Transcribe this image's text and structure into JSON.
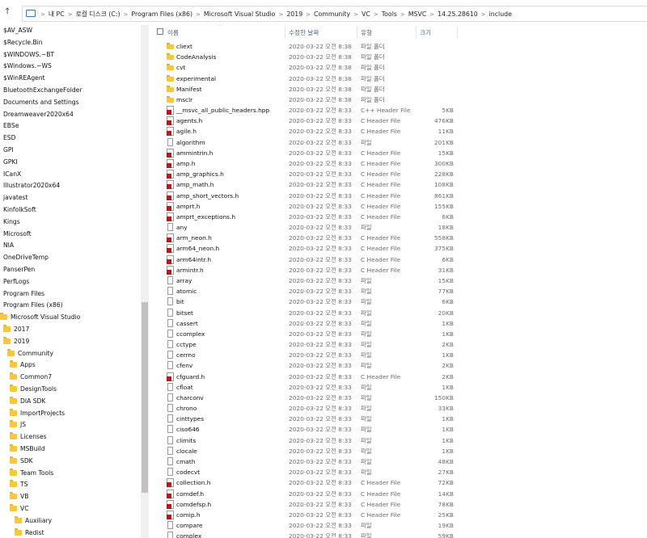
{
  "nav": {
    "back": "←",
    "forward": "→",
    "dropdown": "∨",
    "up": "↑"
  },
  "breadcrumb": [
    "내 PC",
    "로컬 디스크 (C:)",
    "Program Files (x86)",
    "Microsoft Visual Studio",
    "2019",
    "Community",
    "VC",
    "Tools",
    "MSVC",
    "14.25.28610",
    "include"
  ],
  "columns": {
    "name": "이름",
    "date": "수정한 날짜",
    "type": "유형",
    "size": "크기"
  },
  "sidebar": [
    {
      "label": "$AV_ASW",
      "folder": false,
      "indent": 0
    },
    {
      "label": "$Recycle.Bin",
      "folder": false,
      "indent": 0
    },
    {
      "label": "$WINDOWS.~BT",
      "folder": false,
      "indent": 0
    },
    {
      "label": "$Windows.~WS",
      "folder": false,
      "indent": 0
    },
    {
      "label": "$WinREAgent",
      "folder": false,
      "indent": 0
    },
    {
      "label": "BluetoothExchangeFolder",
      "folder": false,
      "indent": 0
    },
    {
      "label": "Documents and Settings",
      "folder": false,
      "indent": 0
    },
    {
      "label": "Dreamweaver2020x64",
      "folder": false,
      "indent": 0
    },
    {
      "label": "EBSe",
      "folder": false,
      "indent": 0
    },
    {
      "label": "ESD",
      "folder": false,
      "indent": 0
    },
    {
      "label": "GPI",
      "folder": false,
      "indent": 0
    },
    {
      "label": "GPKI",
      "folder": false,
      "indent": 0
    },
    {
      "label": "ICanX",
      "folder": false,
      "indent": 0
    },
    {
      "label": "Illustrator2020x64",
      "folder": false,
      "indent": 0
    },
    {
      "label": "javatest",
      "folder": false,
      "indent": 0
    },
    {
      "label": "KinfolkSoft",
      "folder": false,
      "indent": 0
    },
    {
      "label": "Kings",
      "folder": false,
      "indent": 0
    },
    {
      "label": "Microsoft",
      "folder": false,
      "indent": 0
    },
    {
      "label": "NIA",
      "folder": false,
      "indent": 0
    },
    {
      "label": "OneDriveTemp",
      "folder": false,
      "indent": 0
    },
    {
      "label": "PanserPen",
      "folder": false,
      "indent": 0
    },
    {
      "label": "PerfLogs",
      "folder": false,
      "indent": 0
    },
    {
      "label": "Program Files",
      "folder": false,
      "indent": 0
    },
    {
      "label": "Program Files (x86)",
      "folder": false,
      "indent": 0
    },
    {
      "label": "Microsoft Visual Studio",
      "folder": true,
      "indent": 0
    },
    {
      "label": "2017",
      "folder": true,
      "indent": 1
    },
    {
      "label": "2019",
      "folder": true,
      "indent": 1
    },
    {
      "label": "Community",
      "folder": true,
      "indent": 2
    },
    {
      "label": "Apps",
      "folder": true,
      "indent": 3
    },
    {
      "label": "Common7",
      "folder": true,
      "indent": 3
    },
    {
      "label": "DesignTools",
      "folder": true,
      "indent": 3
    },
    {
      "label": "DIA SDK",
      "folder": true,
      "indent": 3
    },
    {
      "label": "ImportProjects",
      "folder": true,
      "indent": 3
    },
    {
      "label": "JS",
      "folder": true,
      "indent": 3
    },
    {
      "label": "Licenses",
      "folder": true,
      "indent": 3
    },
    {
      "label": "MSBuild",
      "folder": true,
      "indent": 3
    },
    {
      "label": "SDK",
      "folder": true,
      "indent": 3
    },
    {
      "label": "Team Tools",
      "folder": true,
      "indent": 3
    },
    {
      "label": "TS",
      "folder": true,
      "indent": 3
    },
    {
      "label": "VB",
      "folder": true,
      "indent": 3
    },
    {
      "label": "VC",
      "folder": true,
      "indent": 3
    },
    {
      "label": "Auxiliary",
      "folder": true,
      "indent": 4
    },
    {
      "label": "Redist",
      "folder": true,
      "indent": 4
    }
  ],
  "files": [
    {
      "name": "cliext",
      "date": "2020-03-22 오전 8:38",
      "type": "파일 폴더",
      "size": "",
      "icon": "folder"
    },
    {
      "name": "CodeAnalysis",
      "date": "2020-03-22 오전 8:38",
      "type": "파일 폴더",
      "size": "",
      "icon": "folder"
    },
    {
      "name": "cvt",
      "date": "2020-03-22 오전 8:38",
      "type": "파일 폴더",
      "size": "",
      "icon": "folder"
    },
    {
      "name": "experimental",
      "date": "2020-03-22 오전 8:38",
      "type": "파일 폴더",
      "size": "",
      "icon": "folder"
    },
    {
      "name": "Manifest",
      "date": "2020-03-22 오전 8:38",
      "type": "파일 폴더",
      "size": "",
      "icon": "folder"
    },
    {
      "name": "msclr",
      "date": "2020-03-22 오전 8:38",
      "type": "파일 폴더",
      "size": "",
      "icon": "folder"
    },
    {
      "name": "__msvc_all_public_headers.hpp",
      "date": "2020-03-22 오전 8:33",
      "type": "C++ Header File",
      "size": "5KB",
      "icon": "header"
    },
    {
      "name": "agents.h",
      "date": "2020-03-22 오전 8:33",
      "type": "C Header File",
      "size": "476KB",
      "icon": "header"
    },
    {
      "name": "agile.h",
      "date": "2020-03-22 오전 8:33",
      "type": "C Header File",
      "size": "11KB",
      "icon": "header"
    },
    {
      "name": "algorithm",
      "date": "2020-03-22 오전 8:33",
      "type": "파일",
      "size": "201KB",
      "icon": "file"
    },
    {
      "name": "ammintrin.h",
      "date": "2020-03-22 오전 8:33",
      "type": "C Header File",
      "size": "15KB",
      "icon": "header"
    },
    {
      "name": "amp.h",
      "date": "2020-03-22 오전 8:33",
      "type": "C Header File",
      "size": "300KB",
      "icon": "header"
    },
    {
      "name": "amp_graphics.h",
      "date": "2020-03-22 오전 8:33",
      "type": "C Header File",
      "size": "228KB",
      "icon": "header"
    },
    {
      "name": "amp_math.h",
      "date": "2020-03-22 오전 8:33",
      "type": "C Header File",
      "size": "108KB",
      "icon": "header"
    },
    {
      "name": "amp_short_vectors.h",
      "date": "2020-03-22 오전 8:33",
      "type": "C Header File",
      "size": "861KB",
      "icon": "header"
    },
    {
      "name": "amprt.h",
      "date": "2020-03-22 오전 8:33",
      "type": "C Header File",
      "size": "155KB",
      "icon": "header"
    },
    {
      "name": "amprt_exceptions.h",
      "date": "2020-03-22 오전 8:33",
      "type": "C Header File",
      "size": "6KB",
      "icon": "header"
    },
    {
      "name": "any",
      "date": "2020-03-22 오전 8:33",
      "type": "파일",
      "size": "18KB",
      "icon": "file"
    },
    {
      "name": "arm_neon.h",
      "date": "2020-03-22 오전 8:33",
      "type": "C Header File",
      "size": "558KB",
      "icon": "header"
    },
    {
      "name": "arm64_neon.h",
      "date": "2020-03-22 오전 8:33",
      "type": "C Header File",
      "size": "375KB",
      "icon": "header"
    },
    {
      "name": "arm64intr.h",
      "date": "2020-03-22 오전 8:33",
      "type": "C Header File",
      "size": "6KB",
      "icon": "header"
    },
    {
      "name": "armintr.h",
      "date": "2020-03-22 오전 8:33",
      "type": "C Header File",
      "size": "31KB",
      "icon": "header"
    },
    {
      "name": "array",
      "date": "2020-03-22 오전 8:33",
      "type": "파일",
      "size": "15KB",
      "icon": "file"
    },
    {
      "name": "atomic",
      "date": "2020-03-22 오전 8:33",
      "type": "파일",
      "size": "77KB",
      "icon": "file"
    },
    {
      "name": "bit",
      "date": "2020-03-22 오전 8:33",
      "type": "파일",
      "size": "6KB",
      "icon": "file"
    },
    {
      "name": "bitset",
      "date": "2020-03-22 오전 8:33",
      "type": "파일",
      "size": "20KB",
      "icon": "file"
    },
    {
      "name": "cassert",
      "date": "2020-03-22 오전 8:33",
      "type": "파일",
      "size": "1KB",
      "icon": "file"
    },
    {
      "name": "ccomplex",
      "date": "2020-03-22 오전 8:33",
      "type": "파일",
      "size": "1KB",
      "icon": "file"
    },
    {
      "name": "cctype",
      "date": "2020-03-22 오전 8:33",
      "type": "파일",
      "size": "2KB",
      "icon": "file"
    },
    {
      "name": "cerrno",
      "date": "2020-03-22 오전 8:33",
      "type": "파일",
      "size": "1KB",
      "icon": "file"
    },
    {
      "name": "cfenv",
      "date": "2020-03-22 오전 8:33",
      "type": "파일",
      "size": "2KB",
      "icon": "file"
    },
    {
      "name": "cfguard.h",
      "date": "2020-03-22 오전 8:33",
      "type": "C Header File",
      "size": "2KB",
      "icon": "header"
    },
    {
      "name": "cfloat",
      "date": "2020-03-22 오전 8:33",
      "type": "파일",
      "size": "1KB",
      "icon": "file"
    },
    {
      "name": "charconv",
      "date": "2020-03-22 오전 8:33",
      "type": "파일",
      "size": "150KB",
      "icon": "file"
    },
    {
      "name": "chrono",
      "date": "2020-03-22 오전 8:33",
      "type": "파일",
      "size": "33KB",
      "icon": "file"
    },
    {
      "name": "cinttypes",
      "date": "2020-03-22 오전 8:33",
      "type": "파일",
      "size": "1KB",
      "icon": "file"
    },
    {
      "name": "ciso646",
      "date": "2020-03-22 오전 8:33",
      "type": "파일",
      "size": "1KB",
      "icon": "file"
    },
    {
      "name": "climits",
      "date": "2020-03-22 오전 8:33",
      "type": "파일",
      "size": "1KB",
      "icon": "file"
    },
    {
      "name": "clocale",
      "date": "2020-03-22 오전 8:33",
      "type": "파일",
      "size": "1KB",
      "icon": "file"
    },
    {
      "name": "cmath",
      "date": "2020-03-22 오전 8:33",
      "type": "파일",
      "size": "48KB",
      "icon": "file"
    },
    {
      "name": "codecvt",
      "date": "2020-03-22 오전 8:33",
      "type": "파일",
      "size": "27KB",
      "icon": "file"
    },
    {
      "name": "collection.h",
      "date": "2020-03-22 오전 8:33",
      "type": "C Header File",
      "size": "72KB",
      "icon": "header"
    },
    {
      "name": "comdef.h",
      "date": "2020-03-22 오전 8:33",
      "type": "C Header File",
      "size": "14KB",
      "icon": "header"
    },
    {
      "name": "comdefsp.h",
      "date": "2020-03-22 오전 8:33",
      "type": "C Header File",
      "size": "78KB",
      "icon": "header"
    },
    {
      "name": "comip.h",
      "date": "2020-03-22 오전 8:33",
      "type": "C Header File",
      "size": "25KB",
      "icon": "header"
    },
    {
      "name": "compare",
      "date": "2020-03-22 오전 8:33",
      "type": "파일",
      "size": "19KB",
      "icon": "file"
    },
    {
      "name": "complex",
      "date": "2020-03-22 오전 8:33",
      "type": "파일",
      "size": "59KB",
      "icon": "file"
    }
  ]
}
